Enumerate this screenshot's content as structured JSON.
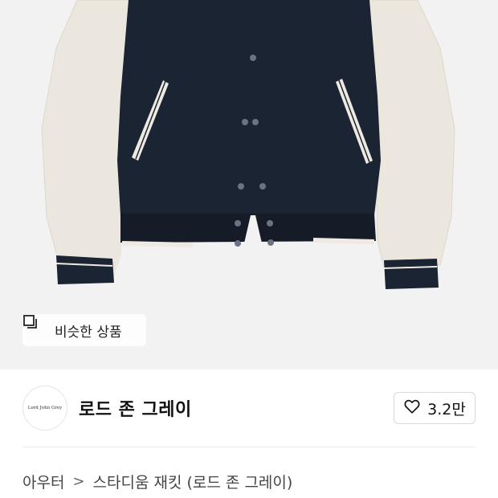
{
  "similar_button": {
    "label": "비슷한 상품",
    "icon": "similar-items-icon"
  },
  "brand": {
    "logo_text": "Lord John Grey",
    "name": "로드 존 그레이"
  },
  "like": {
    "icon": "heart-icon",
    "count": "3.2만"
  },
  "breadcrumb": {
    "category": "아우터",
    "separator": ">",
    "product": "스타디움 재킷 (로드 존 그레이)"
  },
  "colors": {
    "navy": "#1b2433",
    "cream": "#efeae1",
    "bg": "#f2f2f3"
  }
}
